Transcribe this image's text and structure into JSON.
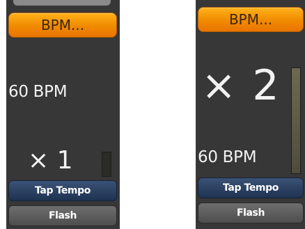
{
  "panels": [
    {
      "bpm_button_label": "BPM...",
      "bpm_readout": "60 BPM",
      "multiplier": "× 1",
      "level_meter_fraction": 0.0,
      "tap_tempo_label": "Tap Tempo",
      "flash_label": "Flash"
    },
    {
      "bpm_button_label": "BPM...",
      "bpm_readout": "60 BPM",
      "multiplier": "× 2",
      "level_meter_fraction": 1.0,
      "tap_tempo_label": "Tap Tempo",
      "flash_label": "Flash"
    }
  ],
  "colors": {
    "panel_background": "#373737",
    "bpm_button": "#f08a00",
    "tap_tempo_button": "#2a4063",
    "flash_button": "#5a5a5a",
    "text": "#f2f2f2"
  }
}
